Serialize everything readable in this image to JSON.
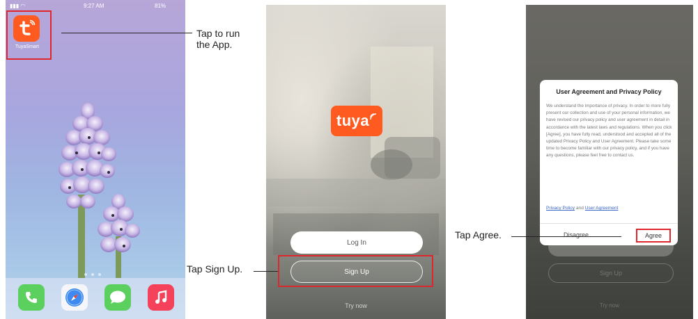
{
  "phone_home": {
    "status": {
      "carrier": "",
      "time": "9:27 AM",
      "battery": "81%"
    },
    "app": {
      "name": "TuyaSmart",
      "icon": "tuya-t-icon",
      "color": "#ff5a1f"
    },
    "dock": [
      "phone-icon",
      "safari-icon",
      "messages-icon",
      "music-icon"
    ]
  },
  "phone_login": {
    "logo_text": "tuya",
    "login_label": "Log In",
    "signup_label": "Sign Up",
    "try_label": "Try now"
  },
  "phone_dialog": {
    "title": "User Agreement and Privacy Policy",
    "body": "We understand the importance of privacy. In order to more fully present our collection and use of your personal information, we have revised our privacy policy and user agreement in detail in accordance with the latest laws and regulations. When you click [Agree], you have fully read, understood and accepted all of the updated Privacy Policy and User Agreement. Please take some time to become familiar with our privacy policy, and if you have any questions, please feel free to contact us.",
    "privacy_link": "Privacy Policy",
    "link_joiner": "and",
    "agreement_link": "User Agreement",
    "disagree_label": "Disagree",
    "agree_label": "Agree",
    "bg_signup_label": "Sign Up",
    "bg_try_label": "Try now"
  },
  "annotations": {
    "tap_run_line1": "Tap to run",
    "tap_run_line2": "the App.",
    "tap_signup": "Tap Sign Up.",
    "tap_agree": "Tap Agree."
  },
  "colors": {
    "highlight": "#e0262d",
    "brand": "#ff5a1f"
  }
}
